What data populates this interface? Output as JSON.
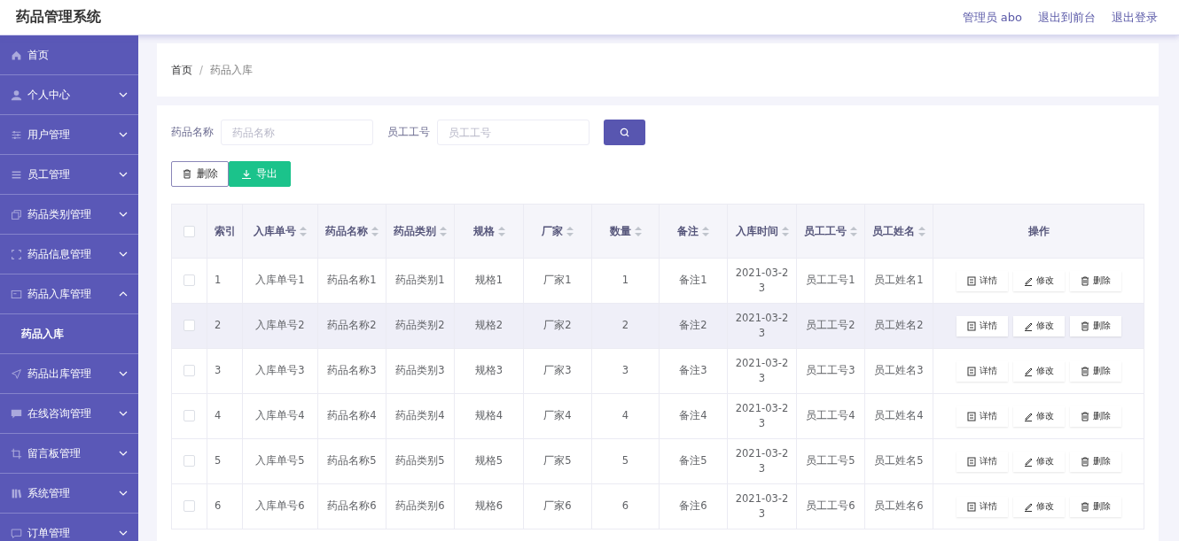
{
  "header": {
    "title": "药品管理系统",
    "links": [
      "管理员 abo",
      "退出到前台",
      "退出登录"
    ]
  },
  "sidebar": {
    "items": [
      {
        "label": "首页"
      },
      {
        "label": "个人中心",
        "expanded": false
      },
      {
        "label": "用户管理",
        "expanded": false
      },
      {
        "label": "员工管理",
        "expanded": false
      },
      {
        "label": "药品类别管理",
        "expanded": false
      },
      {
        "label": "药品信息管理",
        "expanded": false
      },
      {
        "label": "药品入库管理",
        "expanded": true,
        "children": [
          {
            "label": "药品入库",
            "selected": true
          }
        ]
      },
      {
        "label": "药品出库管理",
        "expanded": false
      },
      {
        "label": "在线咨询管理",
        "expanded": false
      },
      {
        "label": "留言板管理",
        "expanded": false
      },
      {
        "label": "系统管理",
        "expanded": false
      },
      {
        "label": "订单管理",
        "expanded": false
      }
    ]
  },
  "breadcrumb": [
    "首页",
    "/",
    "药品入库"
  ],
  "search": {
    "fields": [
      {
        "label": "药品名称",
        "placeholder": "药品名称"
      },
      {
        "label": "员工工号",
        "placeholder": "员工工号"
      }
    ]
  },
  "actions": [
    {
      "label": "删除",
      "kind": "delete"
    },
    {
      "label": "导出",
      "kind": "export"
    }
  ],
  "table": {
    "header_checkbox": {
      "checked": false
    },
    "columns": [
      {
        "label": "索引",
        "sortable": false
      },
      {
        "label": "入库单号",
        "sortable": true
      },
      {
        "label": "药品名称",
        "sortable": true
      },
      {
        "label": "药品类别",
        "sortable": true
      },
      {
        "label": "规格",
        "sortable": true
      },
      {
        "label": "厂家",
        "sortable": true
      },
      {
        "label": "数量",
        "sortable": true
      },
      {
        "label": "备注",
        "sortable": true
      },
      {
        "label": "入库时间",
        "sortable": true
      },
      {
        "label": "员工工号",
        "sortable": true
      },
      {
        "label": "员工姓名",
        "sortable": true
      },
      {
        "label": "操作",
        "sortable": false
      }
    ],
    "rows": [
      {
        "checked": false,
        "highlighted": false,
        "cells": [
          "1",
          "入库单号1",
          "药品名称1",
          "药品类别1",
          "规格1",
          "厂家1",
          "1",
          "备注1",
          "2021-03-23",
          "员工工号1",
          "员工姓名1"
        ],
        "actions": [
          "详情",
          "修改",
          "删除"
        ]
      },
      {
        "checked": false,
        "highlighted": true,
        "cells": [
          "2",
          "入库单号2",
          "药品名称2",
          "药品类别2",
          "规格2",
          "厂家2",
          "2",
          "备注2",
          "2021-03-23",
          "员工工号2",
          "员工姓名2"
        ],
        "actions": [
          "详情",
          "修改",
          "删除"
        ]
      },
      {
        "checked": false,
        "highlighted": false,
        "cells": [
          "3",
          "入库单号3",
          "药品名称3",
          "药品类别3",
          "规格3",
          "厂家3",
          "3",
          "备注3",
          "2021-03-23",
          "员工工号3",
          "员工姓名3"
        ],
        "actions": [
          "详情",
          "修改",
          "删除"
        ]
      },
      {
        "checked": false,
        "highlighted": false,
        "cells": [
          "4",
          "入库单号4",
          "药品名称4",
          "药品类别4",
          "规格4",
          "厂家4",
          "4",
          "备注4",
          "2021-03-23",
          "员工工号4",
          "员工姓名4"
        ],
        "actions": [
          "详情",
          "修改",
          "删除"
        ]
      },
      {
        "checked": false,
        "highlighted": false,
        "cells": [
          "5",
          "入库单号5",
          "药品名称5",
          "药品类别5",
          "规格5",
          "厂家5",
          "5",
          "备注5",
          "2021-03-23",
          "员工工号5",
          "员工姓名5"
        ],
        "actions": [
          "详情",
          "修改",
          "删除"
        ]
      },
      {
        "checked": false,
        "highlighted": false,
        "cells": [
          "6",
          "入库单号6",
          "药品名称6",
          "药品类别6",
          "规格6",
          "厂家6",
          "6",
          "备注6",
          "2021-03-23",
          "员工工号6",
          "员工姓名6"
        ],
        "actions": [
          "详情",
          "修改",
          "删除"
        ]
      }
    ]
  }
}
